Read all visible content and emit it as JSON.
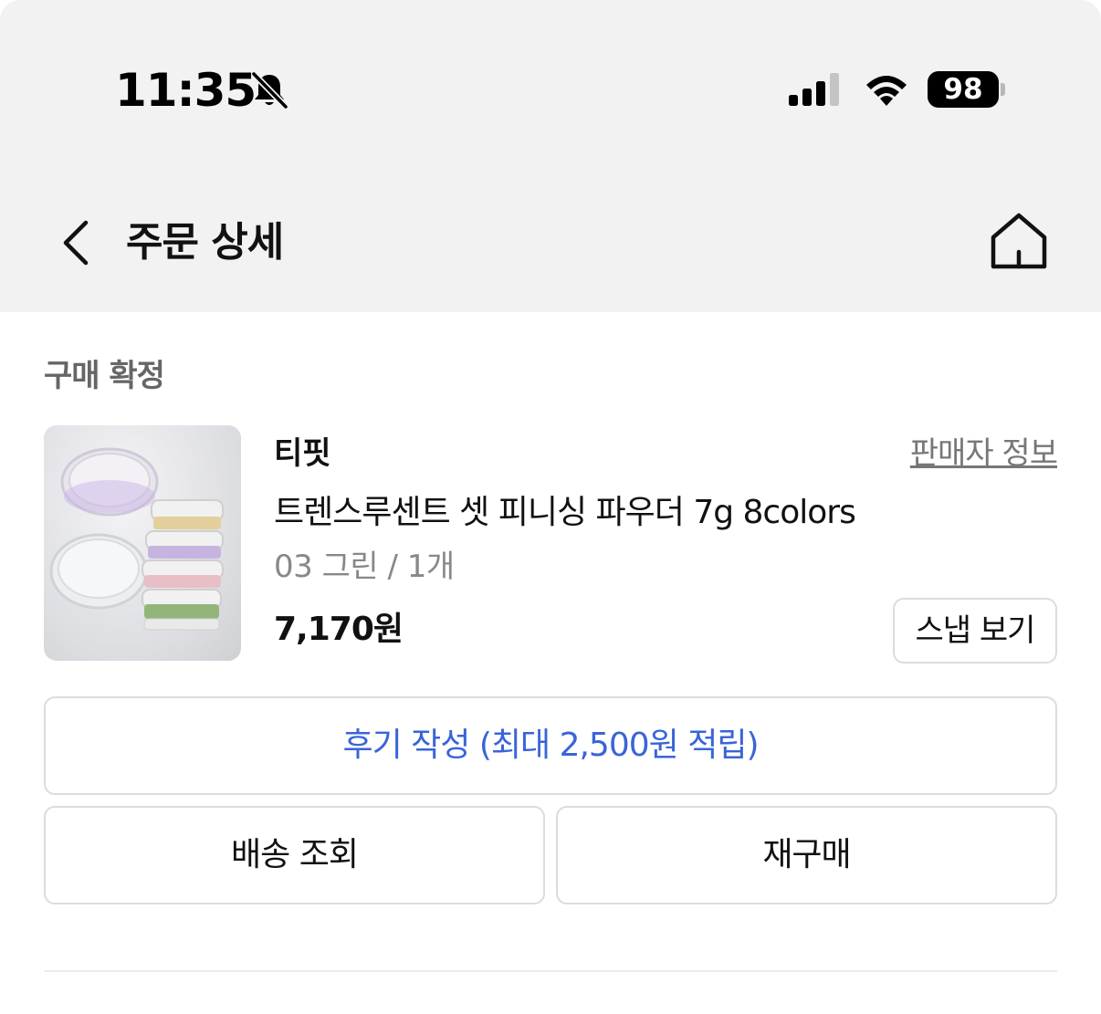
{
  "status_bar": {
    "time": "11:35",
    "battery": "98"
  },
  "header": {
    "title": "주문 상세"
  },
  "order": {
    "status": "구매 확정",
    "seller": "티핏",
    "seller_info_link": "판매자 정보",
    "product_name": "트렌스루센트 셋 피니싱 파우더 7g 8colors",
    "option": "03 그린 / 1개",
    "price": "7,170원",
    "snap_button": "스냅 보기"
  },
  "actions": {
    "review": "후기 작성 (최대 2,500원 적립)",
    "tracking": "배송 조회",
    "reorder": "재구매"
  },
  "colors": {
    "accent": "#3a64d8",
    "header_bg": "#f2f2f2",
    "border": "#dcdcdc",
    "muted_text": "#888888"
  },
  "icons": [
    "bell-slash-icon",
    "signal-icon",
    "wifi-icon",
    "battery-icon",
    "back-chevron-icon",
    "home-icon"
  ]
}
